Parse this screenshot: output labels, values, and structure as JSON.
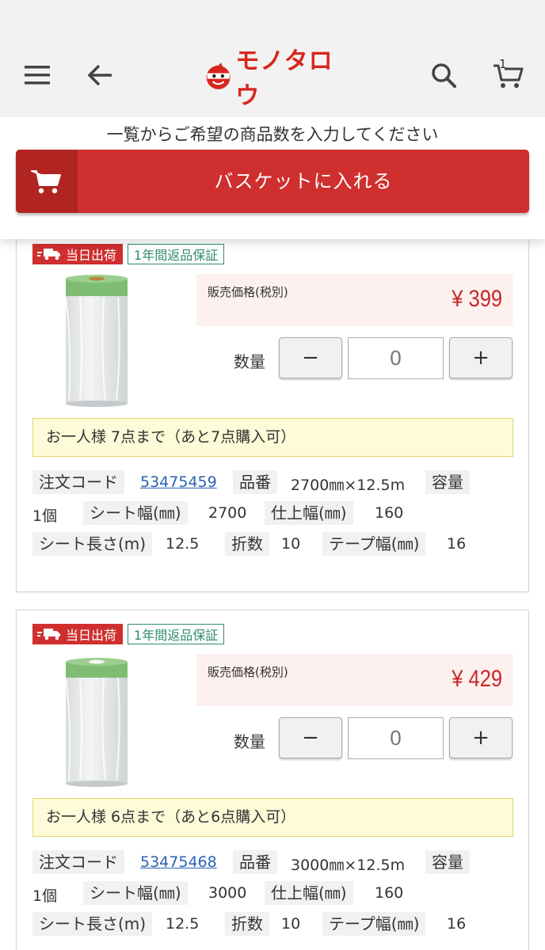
{
  "header": {
    "logo_text": "モノタロウ",
    "cart_count": "1"
  },
  "instruction": "一覧からご希望の商品数を入力してください",
  "basket_button": "バスケットに入れる",
  "badges": {
    "shipping": "当日出荷",
    "return": "1年間返品保証"
  },
  "labels": {
    "price": "販売価格(税別)",
    "quantity": "数量",
    "minus": "−",
    "plus": "+",
    "order_code": "注文コード",
    "part_no": "品番",
    "capacity": "容量",
    "sheet_width": "シート幅(㎜)",
    "finish_width": "仕上幅(㎜)",
    "sheet_length": "シート長さ(m)",
    "folds": "折数",
    "tape_width": "テープ幅(㎜)"
  },
  "products": [
    {
      "price": "¥ 399",
      "qty": "0",
      "limit": "お一人様 7点まで（あと7点購入可）",
      "order_code": "53475459",
      "part_no": "2700㎜×12.5m",
      "capacity": "1個",
      "sheet_width": "2700",
      "finish_width": "160",
      "sheet_length": "12.5",
      "folds": "10",
      "tape_width": "16"
    },
    {
      "price": "¥ 429",
      "qty": "0",
      "limit": "お一人様 6点まで（あと6点購入可）",
      "order_code": "53475468",
      "part_no": "3000㎜×12.5m",
      "capacity": "1個",
      "sheet_width": "3000",
      "finish_width": "160",
      "sheet_length": "12.5",
      "folds": "10",
      "tape_width": "16"
    }
  ],
  "colors": {
    "brand_red": "#cf2f2e",
    "price_red": "#c7282a",
    "badge_green": "#2e8b72",
    "link_blue": "#2b62b1"
  },
  "icons": [
    "menu-icon",
    "back-arrow-icon",
    "search-icon",
    "cart-icon",
    "truck-icon",
    "product-image"
  ]
}
